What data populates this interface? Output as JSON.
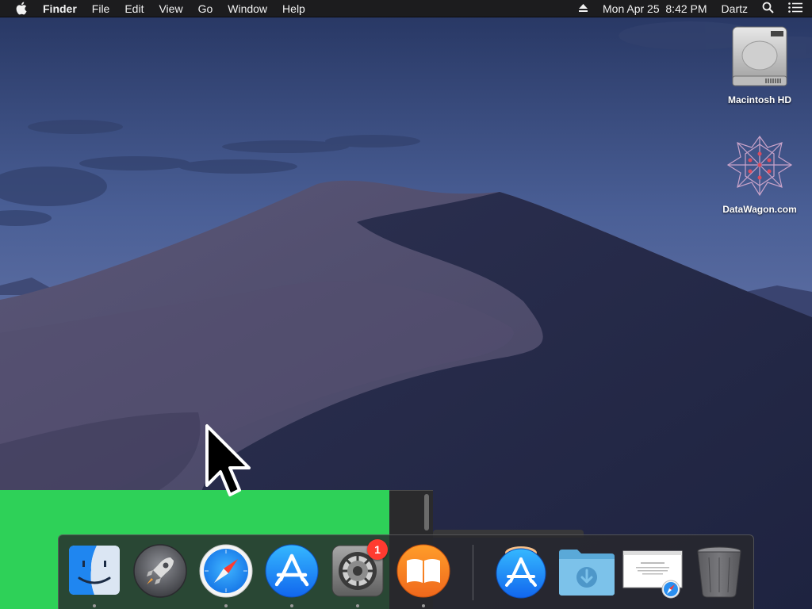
{
  "menubar": {
    "apple_icon": "apple-icon",
    "app_name": "Finder",
    "menus": [
      "File",
      "Edit",
      "View",
      "Go",
      "Window",
      "Help"
    ],
    "eject_icon": "eject-icon",
    "clock": "Mon Apr 25  8:42 PM",
    "user": "Dartz",
    "search_icon": "spotlight-search-icon",
    "list_icon": "notification-center-icon"
  },
  "desktop": {
    "icons": [
      {
        "label": "Macintosh HD",
        "icon": "hard-drive-icon"
      },
      {
        "label": "DataWagon.com",
        "icon": "network-volume-icon"
      }
    ]
  },
  "dock": {
    "apps": [
      {
        "name": "Finder",
        "icon": "finder-icon",
        "running": true
      },
      {
        "name": "Launchpad",
        "icon": "launchpad-rocket-icon",
        "running": false
      },
      {
        "name": "Safari",
        "icon": "safari-compass-icon",
        "running": true
      },
      {
        "name": "App Store",
        "icon": "app-store-icon",
        "running": true
      },
      {
        "name": "System Preferences",
        "icon": "system-preferences-gear-icon",
        "running": true,
        "badge": "1"
      },
      {
        "name": "Books",
        "icon": "books-icon",
        "running": true
      }
    ],
    "others": [
      {
        "name": "App Store Download",
        "icon": "app-store-download-icon"
      },
      {
        "name": "Downloads",
        "icon": "downloads-folder-icon"
      },
      {
        "name": "Safari Window",
        "icon": "safari-window-thumbnail-icon"
      },
      {
        "name": "Trash",
        "icon": "trash-icon"
      }
    ]
  },
  "colors": {
    "menubar_bg": "#1c1c1e",
    "green_window": "#2ed158",
    "badge": "#ff3b30"
  }
}
